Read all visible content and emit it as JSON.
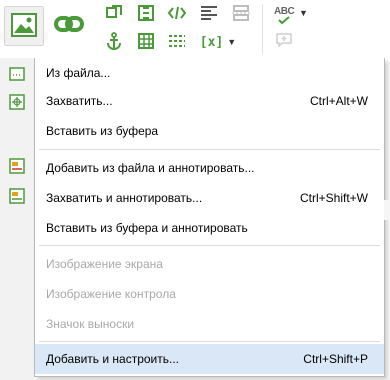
{
  "ribbon": {
    "icons": [
      "insert-image-icon",
      "link-icon",
      "frame-icon",
      "filmstrip-icon",
      "code-icon",
      "align-left-icon",
      "page-break-icon",
      "anchor-icon",
      "table-icon",
      "dashed-rows-icon",
      "variable-icon",
      "spellcheck-icon",
      "comment-icon"
    ],
    "spellcheck_text": "ABC",
    "variable_text": "[x]"
  },
  "menu": {
    "items": [
      {
        "label": "Из файла...",
        "shortcut": "",
        "enabled": true,
        "icon": "image-small-icon"
      },
      {
        "label": "Захватить...",
        "shortcut": "Ctrl+Alt+W",
        "enabled": true,
        "icon": "capture-icon"
      },
      {
        "label": "Вставить из буфера",
        "shortcut": "",
        "enabled": true,
        "icon": ""
      },
      {
        "label": "Добавить из файла и аннотировать...",
        "shortcut": "",
        "enabled": true,
        "icon": "annotate-image-icon"
      },
      {
        "label": "Захватить и аннотировать...",
        "shortcut": "Ctrl+Shift+W",
        "enabled": true,
        "icon": "annotate-capture-icon"
      },
      {
        "label": "Вставить из буфера и аннотировать",
        "shortcut": "",
        "enabled": true,
        "icon": ""
      },
      {
        "label": "Изображение экрана",
        "shortcut": "",
        "enabled": false,
        "icon": ""
      },
      {
        "label": "Изображение контрола",
        "shortcut": "",
        "enabled": false,
        "icon": ""
      },
      {
        "label": "Значок выноски",
        "shortcut": "",
        "enabled": false,
        "icon": ""
      },
      {
        "label": "Добавить и настроить...",
        "shortcut": "Ctrl+Shift+P",
        "enabled": true,
        "icon": ""
      }
    ]
  },
  "colors": {
    "accent_green": "#4a9a3a",
    "highlight": "#d9e7f6",
    "disabled_text": "#a9a9a9"
  }
}
